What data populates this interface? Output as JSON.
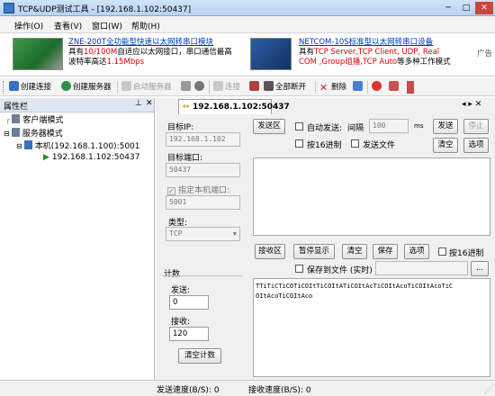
{
  "window": {
    "title": "TCP&UDP测试工具 - [192.168.1.102:50437]"
  },
  "menu": [
    "操作(O)",
    "查看(V)",
    "窗口(W)",
    "帮助(H)"
  ],
  "ads": {
    "left_title": "ZNE-200T全功能型快速以太网转串口模块",
    "left_line2a": "具有",
    "left_line2b": "10/100M",
    "left_line2c": "自适应以太网接口，串口通信最高",
    "left_line3a": "波特率高达",
    "left_line3b": "1.15Mbps",
    "right_title": "NETCOM-10S标准型以太网转串口设备",
    "right_line2a": "具有",
    "right_line2b": "TCP Server,TCP Client, UDP, Real",
    "right_line3a": "COM ,Group组播,TCP Auto",
    "right_line3b": "等多种工作模式",
    "side": "广告"
  },
  "toolbar": {
    "create_conn": "创建连接",
    "create_server": "创建服务器",
    "start_server": "启动服务器",
    "connect": "连接",
    "disconnect_all": "全部断开",
    "delete": "删除"
  },
  "leftpanel": {
    "title": "属性栏",
    "client_mode": "客户端模式",
    "server_mode": "服务器模式",
    "local": "本机(192.168.1.100):5001",
    "conn": "192.168.1.102:50437"
  },
  "tab": {
    "label": "192.168.1.102:50437"
  },
  "config": {
    "target_ip_label": "目标IP:",
    "target_ip": "192.168.1.102",
    "target_port_label": "目标端口:",
    "target_port": "50437",
    "local_port_check": "指定本机端口:",
    "local_port": "5001",
    "type_label": "类型:",
    "type_value": "TCP"
  },
  "counter": {
    "title": "计数",
    "send_label": "发送:",
    "send_value": "0",
    "recv_label": "接收:",
    "recv_value": "120",
    "clear": "清空计数"
  },
  "send": {
    "area_label": "发送区",
    "auto_send": "自动发送:",
    "interval_label": "间隔",
    "interval_value": "100",
    "interval_unit": "ms",
    "send_btn": "发送",
    "stop_btn": "停止",
    "hex": "按16进制",
    "send_file": "发送文件",
    "clear_btn": "清空",
    "options_btn": "选项"
  },
  "recv": {
    "area_label": "接收区",
    "pause": "暂停显示",
    "clear": "清空",
    "save": "保存",
    "options": "选项",
    "hex": "按16进制",
    "save_to_file": "保存到文件 (实时)",
    "content_line1": "TTiTiCTiCOTiCOItTiCOItATiCOItAcTiCOItAcoTiCOItAcoTiC",
    "content_line2": "OItAcoTiCOItAco"
  },
  "status": {
    "send_speed": "发送速度(B/S): 0",
    "recv_speed": "接收速度(B/S): 0"
  },
  "colors": {
    "link": "#0033cc",
    "accent_red": "#e00000",
    "titlebar": "#b9d3f0"
  }
}
